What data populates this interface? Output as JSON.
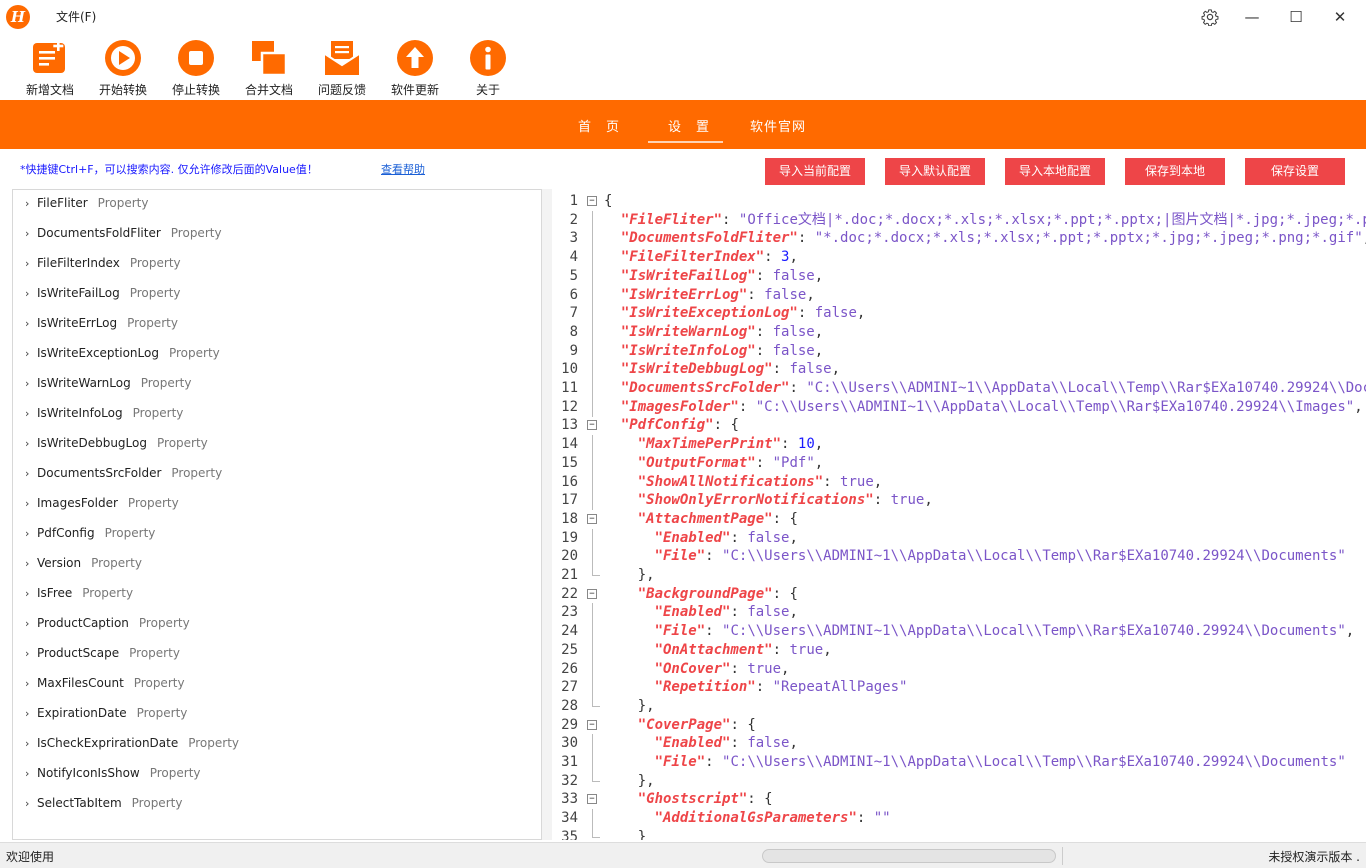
{
  "app": {
    "logo_letter": "H",
    "menu_file": "文件(F)"
  },
  "window": {
    "settings_icon": "gear-icon",
    "minimize": "—",
    "maximize": "☐",
    "close": "✕"
  },
  "toolbar": [
    {
      "label": "新增文档",
      "icon": "new-document-icon"
    },
    {
      "label": "开始转换",
      "icon": "play-icon"
    },
    {
      "label": "停止转换",
      "icon": "stop-icon"
    },
    {
      "label": "合并文档",
      "icon": "merge-icon"
    },
    {
      "label": "问题反馈",
      "icon": "mail-icon"
    },
    {
      "label": "软件更新",
      "icon": "upload-arrow-icon"
    },
    {
      "label": "关于",
      "icon": "info-icon"
    }
  ],
  "nav": {
    "tabs": [
      "首　页",
      "设　置",
      "软件官网"
    ],
    "active": "设　置"
  },
  "hint": {
    "text": "*快捷键Ctrl+F，可以搜索内容.   仅允许修改后面的Value值！",
    "help_link": "查看帮助"
  },
  "actions": [
    "导入当前配置",
    "导入默认配置",
    "导入本地配置",
    "保存到本地",
    "保存设置"
  ],
  "properties": {
    "type_label": "Property",
    "items": [
      "FileFliter",
      "DocumentsFoldFliter",
      "FileFilterIndex",
      "IsWriteFailLog",
      "IsWriteErrLog",
      "IsWriteExceptionLog",
      "IsWriteWarnLog",
      "IsWriteInfoLog",
      "IsWriteDebbugLog",
      "DocumentsSrcFolder",
      "ImagesFolder",
      "PdfConfig",
      "Version",
      "IsFree",
      "ProductCaption",
      "ProductScape",
      "MaxFilesCount",
      "ExpirationDate",
      "IsCheckExprirationDate",
      "NotifyIconIsShow",
      "SelectTabItem"
    ]
  },
  "code_lines": [
    {
      "n": "1",
      "t": "{",
      "fold": "open"
    },
    {
      "n": "2",
      "t": "  \"FileFliter\": \"Office文档|*.doc;*.docx;*.xls;*.xlsx;*.ppt;*.pptx;|图片文档|*.jpg;*.jpeg;*.png;\","
    },
    {
      "n": "3",
      "t": "  \"DocumentsFoldFliter\": \"*.doc;*.docx;*.xls;*.xlsx;*.ppt;*.pptx;*.jpg;*.jpeg;*.png;*.gif\","
    },
    {
      "n": "4",
      "t": "  \"FileFilterIndex\": 3,"
    },
    {
      "n": "5",
      "t": "  \"IsWriteFailLog\": false,"
    },
    {
      "n": "6",
      "t": "  \"IsWriteErrLog\": false,"
    },
    {
      "n": "7",
      "t": "  \"IsWriteExceptionLog\": false,"
    },
    {
      "n": "8",
      "t": "  \"IsWriteWarnLog\": false,"
    },
    {
      "n": "9",
      "t": "  \"IsWriteInfoLog\": false,"
    },
    {
      "n": "10",
      "t": "  \"IsWriteDebbugLog\": false,"
    },
    {
      "n": "11",
      "t": "  \"DocumentsSrcFolder\": \"C:\\\\Users\\\\ADMINI~1\\\\AppData\\\\Local\\\\Temp\\\\Rar$EXa10740.29924\\\\Documents\","
    },
    {
      "n": "12",
      "t": "  \"ImagesFolder\": \"C:\\\\Users\\\\ADMINI~1\\\\AppData\\\\Local\\\\Temp\\\\Rar$EXa10740.29924\\\\Images\","
    },
    {
      "n": "13",
      "t": "  \"PdfConfig\": {",
      "fold": "open"
    },
    {
      "n": "14",
      "t": "    \"MaxTimePerPrint\": 10,"
    },
    {
      "n": "15",
      "t": "    \"OutputFormat\": \"Pdf\","
    },
    {
      "n": "16",
      "t": "    \"ShowAllNotifications\": true,"
    },
    {
      "n": "17",
      "t": "    \"ShowOnlyErrorNotifications\": true,"
    },
    {
      "n": "18",
      "t": "    \"AttachmentPage\": {",
      "fold": "open"
    },
    {
      "n": "19",
      "t": "      \"Enabled\": false,"
    },
    {
      "n": "20",
      "t": "      \"File\": \"C:\\\\Users\\\\ADMINI~1\\\\AppData\\\\Local\\\\Temp\\\\Rar$EXa10740.29924\\\\Documents\""
    },
    {
      "n": "21",
      "t": "    },",
      "fold": "end"
    },
    {
      "n": "22",
      "t": "    \"BackgroundPage\": {",
      "fold": "open"
    },
    {
      "n": "23",
      "t": "      \"Enabled\": false,"
    },
    {
      "n": "24",
      "t": "      \"File\": \"C:\\\\Users\\\\ADMINI~1\\\\AppData\\\\Local\\\\Temp\\\\Rar$EXa10740.29924\\\\Documents\","
    },
    {
      "n": "25",
      "t": "      \"OnAttachment\": true,"
    },
    {
      "n": "26",
      "t": "      \"OnCover\": true,"
    },
    {
      "n": "27",
      "t": "      \"Repetition\": \"RepeatAllPages\""
    },
    {
      "n": "28",
      "t": "    },",
      "fold": "end"
    },
    {
      "n": "29",
      "t": "    \"CoverPage\": {",
      "fold": "open"
    },
    {
      "n": "30",
      "t": "      \"Enabled\": false,"
    },
    {
      "n": "31",
      "t": "      \"File\": \"C:\\\\Users\\\\ADMINI~1\\\\AppData\\\\Local\\\\Temp\\\\Rar$EXa10740.29924\\\\Documents\""
    },
    {
      "n": "32",
      "t": "    },",
      "fold": "end"
    },
    {
      "n": "33",
      "t": "    \"Ghostscript\": {",
      "fold": "open"
    },
    {
      "n": "34",
      "t": "      \"AdditionalGsParameters\": \"\""
    },
    {
      "n": "35",
      "t": "    }",
      "fold": "end"
    }
  ],
  "status": {
    "left": "欢迎使用",
    "right": "未授权演示版本 ."
  },
  "colors": {
    "accent": "#ff6a00",
    "button": "#ee4548",
    "key": "#ee4548",
    "string": "#7b55c8",
    "number": "#1a1aff"
  }
}
